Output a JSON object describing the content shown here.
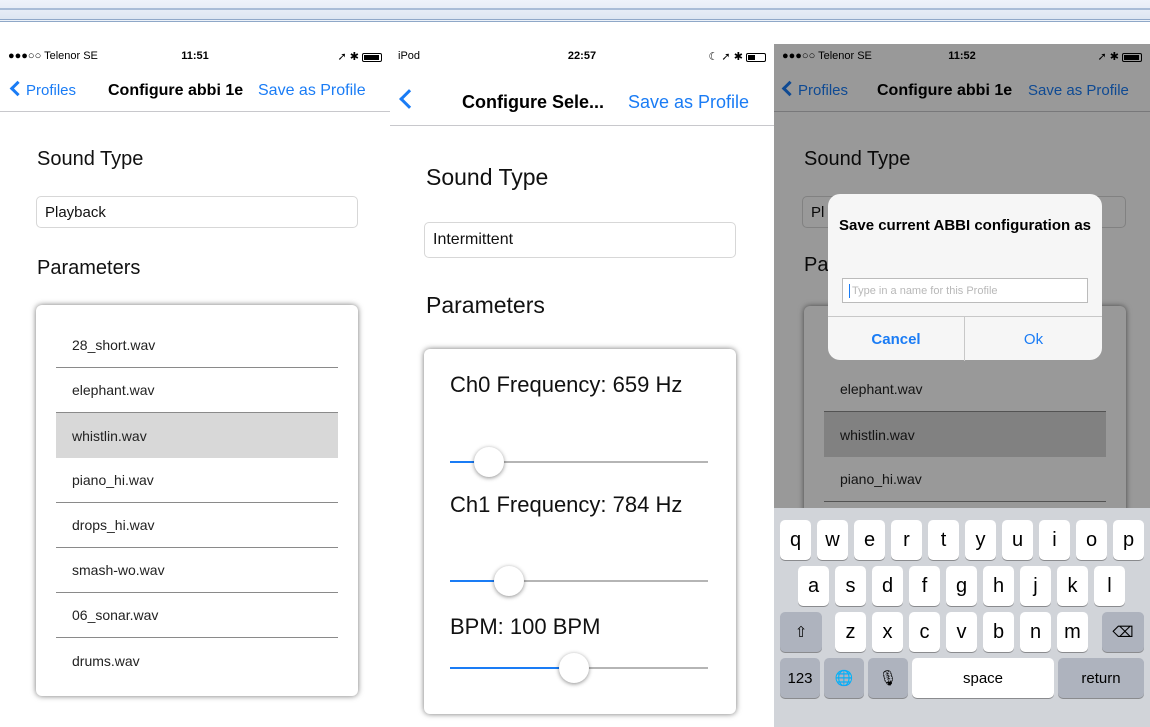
{
  "screen1": {
    "status": {
      "carrier": "●●●○○ Telenor SE",
      "time": "11:51",
      "icons": "➚ ✱"
    },
    "nav": {
      "back": "Profiles",
      "title": "Configure abbi 1e",
      "right": "Save as Profile"
    },
    "sound_type_heading": "Sound Type",
    "sound_type_value": "Playback",
    "parameters_heading": "Parameters",
    "files": [
      "28_short.wav",
      "elephant.wav",
      "whistlin.wav",
      "piano_hi.wav",
      "drops_hi.wav",
      "smash-wo.wav",
      "06_sonar.wav",
      "drums.wav"
    ],
    "selected_file": "whistlin.wav"
  },
  "screen2": {
    "status": {
      "carrier": "iPod",
      "time": "22:57",
      "icons": "☾ ➚ ✱"
    },
    "nav": {
      "title": "Configure Sele...",
      "right": "Save as Profile"
    },
    "sound_type_heading": "Sound Type",
    "sound_type_value": "Intermittent",
    "parameters_heading": "Parameters",
    "sliders": [
      {
        "label": "Ch0 Frequency: 659 Hz",
        "fraction": 0.15
      },
      {
        "label": "Ch1 Frequency: 784 Hz",
        "fraction": 0.23
      },
      {
        "label": "BPM: 100 BPM",
        "fraction": 0.48
      }
    ]
  },
  "screen3": {
    "status": {
      "carrier": "●●●○○ Telenor SE",
      "time": "11:52",
      "icons": "➚ ✱"
    },
    "nav": {
      "back": "Profiles",
      "title": "Configure abbi 1e",
      "right": "Save as Profile"
    },
    "sound_type_heading": "Sound Type",
    "sound_type_value": "Pl",
    "parameters_heading": "Pa",
    "visible_files": [
      "elephant.wav",
      "whistlin.wav",
      "piano_hi.wav"
    ],
    "dialog": {
      "title": "Save current ABBI configuration as",
      "placeholder": "Type in a name for this Profile",
      "cancel": "Cancel",
      "ok": "Ok"
    },
    "keyboard": {
      "row1": [
        "q",
        "w",
        "e",
        "r",
        "t",
        "y",
        "u",
        "i",
        "o",
        "p"
      ],
      "row2": [
        "a",
        "s",
        "d",
        "f",
        "g",
        "h",
        "j",
        "k",
        "l"
      ],
      "row3": [
        "z",
        "x",
        "c",
        "v",
        "b",
        "n",
        "m"
      ],
      "numbers": "123",
      "space": "space",
      "return": "return"
    }
  },
  "colors": {
    "accent": "#1a7cf5",
    "selected_row": "#d8d8d8",
    "keyboard_bg": "#d1d4d9"
  }
}
